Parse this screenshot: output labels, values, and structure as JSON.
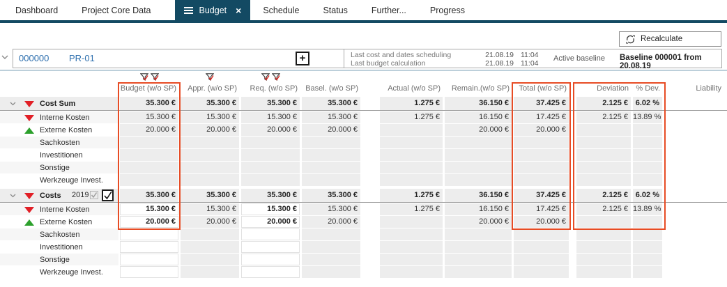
{
  "tabs": [
    {
      "label": "Dashboard",
      "active": false
    },
    {
      "label": "Project Core Data",
      "active": false
    },
    {
      "label": "Budget",
      "active": true
    },
    {
      "label": "Schedule",
      "active": false
    },
    {
      "label": "Status",
      "active": false
    },
    {
      "label": "Further...",
      "active": false
    },
    {
      "label": "Progress",
      "active": false
    }
  ],
  "toolbar": {
    "recalculate_label": "Recalculate"
  },
  "project": {
    "id": "000000",
    "code": "PR-01",
    "add_button": "+",
    "status_lines": [
      {
        "label": "Last cost and dates scheduling",
        "date": "21.08.19",
        "time": "11:04"
      },
      {
        "label": "Last budget calculation",
        "date": "21.08.19",
        "time": "11:04"
      }
    ],
    "active_baseline_label": "Active baseline",
    "baseline_value": "Baseline 000001 from 20.08.19"
  },
  "table": {
    "columns": [
      {
        "key": "budget",
        "label": "Budget (w/o SP)",
        "filters": 2,
        "highlighted": true
      },
      {
        "key": "appr",
        "label": "Appr. (w/o SP)",
        "filters": 1,
        "highlighted": false
      },
      {
        "key": "req",
        "label": "Req. (w/o SP)",
        "filters": 2,
        "highlighted": false
      },
      {
        "key": "basel",
        "label": "Basel. (w/o SP)",
        "filters": 0,
        "highlighted": false
      },
      {
        "key": "actual",
        "label": "Actual (w/o SP)",
        "filters": 0,
        "highlighted": false
      },
      {
        "key": "remain",
        "label": "Remain.(w/o SP)",
        "filters": 0,
        "highlighted": false
      },
      {
        "key": "total",
        "label": "Total (w/o SP)",
        "filters": 0,
        "highlighted": true
      },
      {
        "key": "deviation",
        "label": "Deviation",
        "filters": 0,
        "highlighted": true
      },
      {
        "key": "pdev",
        "label": "% Dev.",
        "filters": 0,
        "highlighted": true
      },
      {
        "key": "liability",
        "label": "Liability",
        "filters": 0,
        "highlighted": false
      }
    ],
    "blocks": [
      {
        "editable": false,
        "rows": [
          {
            "label": "Cost Sum",
            "summary": true,
            "expander": true,
            "icon": "triangle-down-red",
            "cells": [
              "35.300 €",
              "35.300 €",
              "35.300 €",
              "35.300 €",
              "1.275 €",
              "36.150 €",
              "37.425 €",
              "2.125 €",
              "6.02 %",
              ""
            ]
          },
          {
            "label": "Interne Kosten",
            "summary": false,
            "expander": false,
            "icon": "triangle-down-red",
            "cells": [
              "15.300 €",
              "15.300 €",
              "15.300 €",
              "15.300 €",
              "1.275 €",
              "16.150 €",
              "17.425 €",
              "2.125 €",
              "13.89 %",
              ""
            ]
          },
          {
            "label": "Externe Kosten",
            "summary": false,
            "expander": false,
            "icon": "triangle-up-green",
            "cells": [
              "20.000 €",
              "20.000 €",
              "20.000 €",
              "20.000 €",
              "",
              "20.000 €",
              "20.000 €",
              "",
              "",
              ""
            ]
          },
          {
            "label": "Sachkosten",
            "summary": false,
            "expander": false,
            "icon": null,
            "cells": [
              "",
              "",
              "",
              "",
              "",
              "",
              "",
              "",
              "",
              ""
            ]
          },
          {
            "label": "Investitionen",
            "summary": false,
            "expander": false,
            "icon": null,
            "cells": [
              "",
              "",
              "",
              "",
              "",
              "",
              "",
              "",
              "",
              ""
            ]
          },
          {
            "label": "Sonstige",
            "summary": false,
            "expander": false,
            "icon": null,
            "cells": [
              "",
              "",
              "",
              "",
              "",
              "",
              "",
              "",
              "",
              ""
            ]
          },
          {
            "label": "Werkzeuge Invest.",
            "summary": false,
            "expander": false,
            "icon": null,
            "cells": [
              "",
              "",
              "",
              "",
              "",
              "",
              "",
              "",
              "",
              ""
            ]
          }
        ]
      },
      {
        "editable": true,
        "rows": [
          {
            "label": "Costs",
            "summary": true,
            "expander": true,
            "icon": "triangle-down-red",
            "year": "2019",
            "checkbox_disabled_checked": true,
            "checkbox_checked": true,
            "cells": [
              "35.300 €",
              "35.300 €",
              "35.300 €",
              "35.300 €",
              "1.275 €",
              "36.150 €",
              "37.425 €",
              "2.125 €",
              "6.02 %",
              ""
            ]
          },
          {
            "label": "Interne Kosten",
            "summary": false,
            "expander": false,
            "icon": "triangle-down-red",
            "cells": [
              "15.300 €",
              "15.300 €",
              "15.300 €",
              "15.300 €",
              "1.275 €",
              "16.150 €",
              "17.425 €",
              "2.125 €",
              "13.89 %",
              ""
            ]
          },
          {
            "label": "Externe Kosten",
            "summary": false,
            "expander": false,
            "icon": "triangle-up-green",
            "cells": [
              "20.000 €",
              "20.000 €",
              "20.000 €",
              "20.000 €",
              "",
              "20.000 €",
              "20.000 €",
              "",
              "",
              ""
            ]
          },
          {
            "label": "Sachkosten",
            "summary": false,
            "expander": false,
            "icon": null,
            "cells": [
              "",
              "",
              "",
              "",
              "",
              "",
              "",
              "",
              "",
              ""
            ]
          },
          {
            "label": "Investitionen",
            "summary": false,
            "expander": false,
            "icon": null,
            "cells": [
              "",
              "",
              "",
              "",
              "",
              "",
              "",
              "",
              "",
              ""
            ]
          },
          {
            "label": "Sonstige",
            "summary": false,
            "expander": false,
            "icon": null,
            "cells": [
              "",
              "",
              "",
              "",
              "",
              "",
              "",
              "",
              "",
              ""
            ]
          },
          {
            "label": "Werkzeuge Invest.",
            "summary": false,
            "expander": false,
            "icon": null,
            "cells": [
              "",
              "",
              "",
              "",
              "",
              "",
              "",
              "",
              "",
              ""
            ]
          }
        ]
      }
    ]
  },
  "colors": {
    "accent_navy": "#134a63",
    "highlight_orange": "#e74c25",
    "negative_red": "#e11f26",
    "positive_green": "#2ca02c",
    "link_blue": "#2d6fae",
    "cell_gray": "#ededed"
  }
}
